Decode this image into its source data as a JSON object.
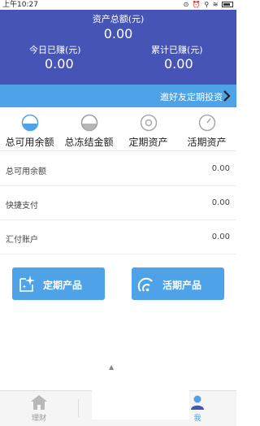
{
  "status_bar": {
    "time": "上午10:27",
    "icons": "⊙ ⏰ ⚲ ≋"
  },
  "header": {
    "total_label": "资产总额(元)",
    "total_value": "0.00",
    "today_label": "今日已赚(元)",
    "today_value": "0.00",
    "cumulative_label": "累计已赚(元)",
    "cumulative_value": "0.00"
  },
  "invite": {
    "text": "邀好友定期投资"
  },
  "tabs": [
    {
      "label": "总可用余额",
      "icon": "half-filled-circle-icon",
      "active": true
    },
    {
      "label": "总冻结金额",
      "icon": "half-gray-circle-icon",
      "active": false
    },
    {
      "label": "定期资产",
      "icon": "ring-circle-icon",
      "active": false
    },
    {
      "label": "活期资产",
      "icon": "gauge-circle-icon",
      "active": false
    }
  ],
  "rows": [
    {
      "name": "总可用余额",
      "value": "0.00"
    },
    {
      "name": "快捷支付",
      "value": "0.00"
    },
    {
      "name": "汇付账户",
      "value": "0.00"
    }
  ],
  "buttons": {
    "fixed_label": "定期产品",
    "current_label": "活期产品"
  },
  "bottom_nav": {
    "finance_label": "理财",
    "me_label": "我"
  },
  "colors": {
    "header_bg": "#4654b6",
    "accent": "#4ea3e8"
  }
}
